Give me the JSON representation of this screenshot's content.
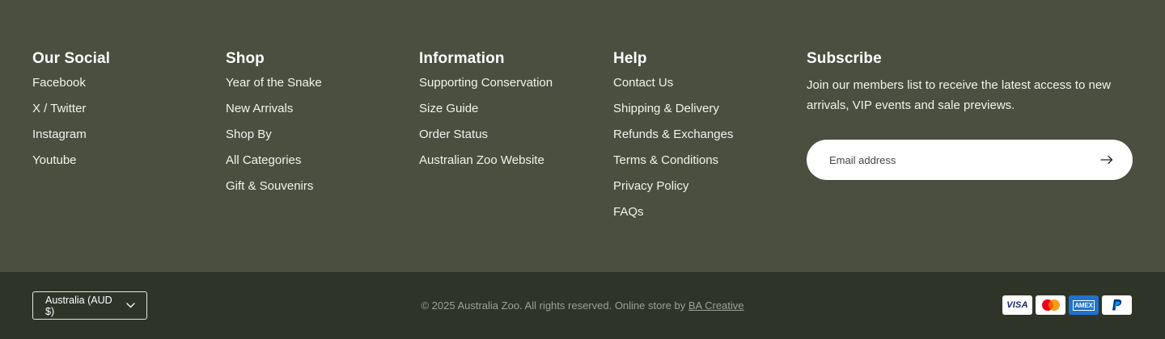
{
  "columns": {
    "social": {
      "title": "Our Social",
      "links": [
        "Facebook",
        "X / Twitter",
        "Instagram",
        "Youtube"
      ]
    },
    "shop": {
      "title": "Shop",
      "links": [
        "Year of the Snake",
        "New Arrivals",
        "Shop By",
        "All Categories",
        "Gift & Souvenirs"
      ]
    },
    "information": {
      "title": "Information",
      "links": [
        "Supporting Conservation",
        "Size Guide",
        "Order Status",
        "Australian Zoo Website"
      ]
    },
    "help": {
      "title": "Help",
      "links": [
        "Contact Us",
        "Shipping & Delivery",
        "Refunds & Exchanges",
        "Terms & Conditions",
        "Privacy Policy",
        "FAQs"
      ]
    }
  },
  "subscribe": {
    "title": "Subscribe",
    "text": "Join our members list to receive the latest access to new arrivals, VIP events and sale previews.",
    "email_placeholder": "Email address",
    "submit_icon": "arrow-right-icon"
  },
  "bottom": {
    "currency": "Australia (AUD $)",
    "copyright_prefix": "© 2025 Australia Zoo. All rights reserved. Online store by ",
    "copyright_link": "BA Creative",
    "payments": [
      "Visa",
      "Mastercard",
      "American Express",
      "PayPal"
    ],
    "payment_labels": {
      "visa": "VISA",
      "amex": "AMEX"
    }
  },
  "colors": {
    "footer_top": "#4a4f40",
    "footer_bottom": "#2f3429",
    "text": "#ffffff",
    "muted": "#9da093"
  }
}
